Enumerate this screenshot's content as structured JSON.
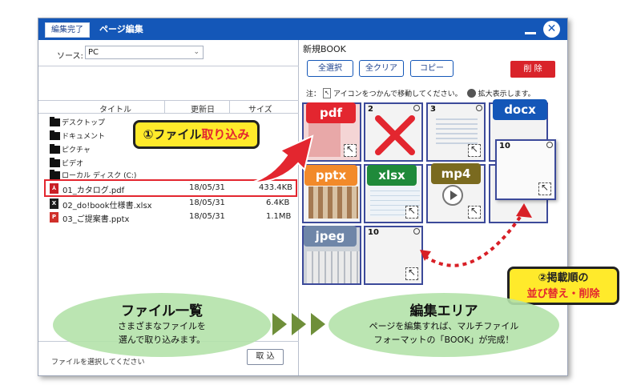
{
  "window": {
    "done_button": "編集完了",
    "title": "ページ編集",
    "close_glyph": "✕"
  },
  "left": {
    "source_label": "ソース:",
    "source_value": "PC",
    "columns": {
      "title": "タイトル",
      "date": "更新日",
      "size": "サイズ"
    },
    "folders": [
      "デスクトップ",
      "ドキュメント",
      "ピクチャ",
      "ビデオ",
      "ローカル ディスク (C:)"
    ],
    "files": [
      {
        "name": "01_カタログ.pdf",
        "date": "18/05/31",
        "size": "433.4KB",
        "icon": "pdf-file-icon"
      },
      {
        "name": "02_do!book仕様書.xlsx",
        "date": "18/05/31",
        "size": "6.4KB",
        "icon": "excel-file-icon"
      },
      {
        "name": "03_ご提案書.pptx",
        "date": "18/05/31",
        "size": "1.1MB",
        "icon": "powerpoint-file-icon"
      }
    ],
    "status": "ファイルを選択してください",
    "import_button": "取 込"
  },
  "right": {
    "title": "新規BOOK",
    "buttons": {
      "select_all": "全選択",
      "clear_all": "全クリア",
      "copy": "コピー",
      "delete": "削 除"
    },
    "note": {
      "prefix": "注：",
      "move": "アイコンをつかんで移動してください。",
      "zoom": "拡大表示します。"
    },
    "thumbnails": [
      "2",
      "3",
      "10",
      "10"
    ],
    "tags": [
      "pdf",
      "docx",
      "pptx",
      "xlsx",
      "mp4",
      "jpeg"
    ]
  },
  "callouts": {
    "import": {
      "num": "①ファイル",
      "red": "取り込み"
    },
    "reorder": {
      "line1": "②掲載順の",
      "line2": "並び替え・削除"
    }
  },
  "ellipses": {
    "list": {
      "heading": "ファイル一覧",
      "line1": "さまざまなファイルを",
      "line2": "選んで取り込みます。"
    },
    "edit": {
      "heading": "編集エリア",
      "line1": "ページを編集すれば、マルチファイル",
      "line2": "フォーマットの「BOOK」が完成！"
    }
  },
  "colors": {
    "titlebar": "#1457b8",
    "accent_red": "#e3262f",
    "highlight_yellow": "#ffea2b",
    "ellipse_green": "#b4e2aa"
  }
}
